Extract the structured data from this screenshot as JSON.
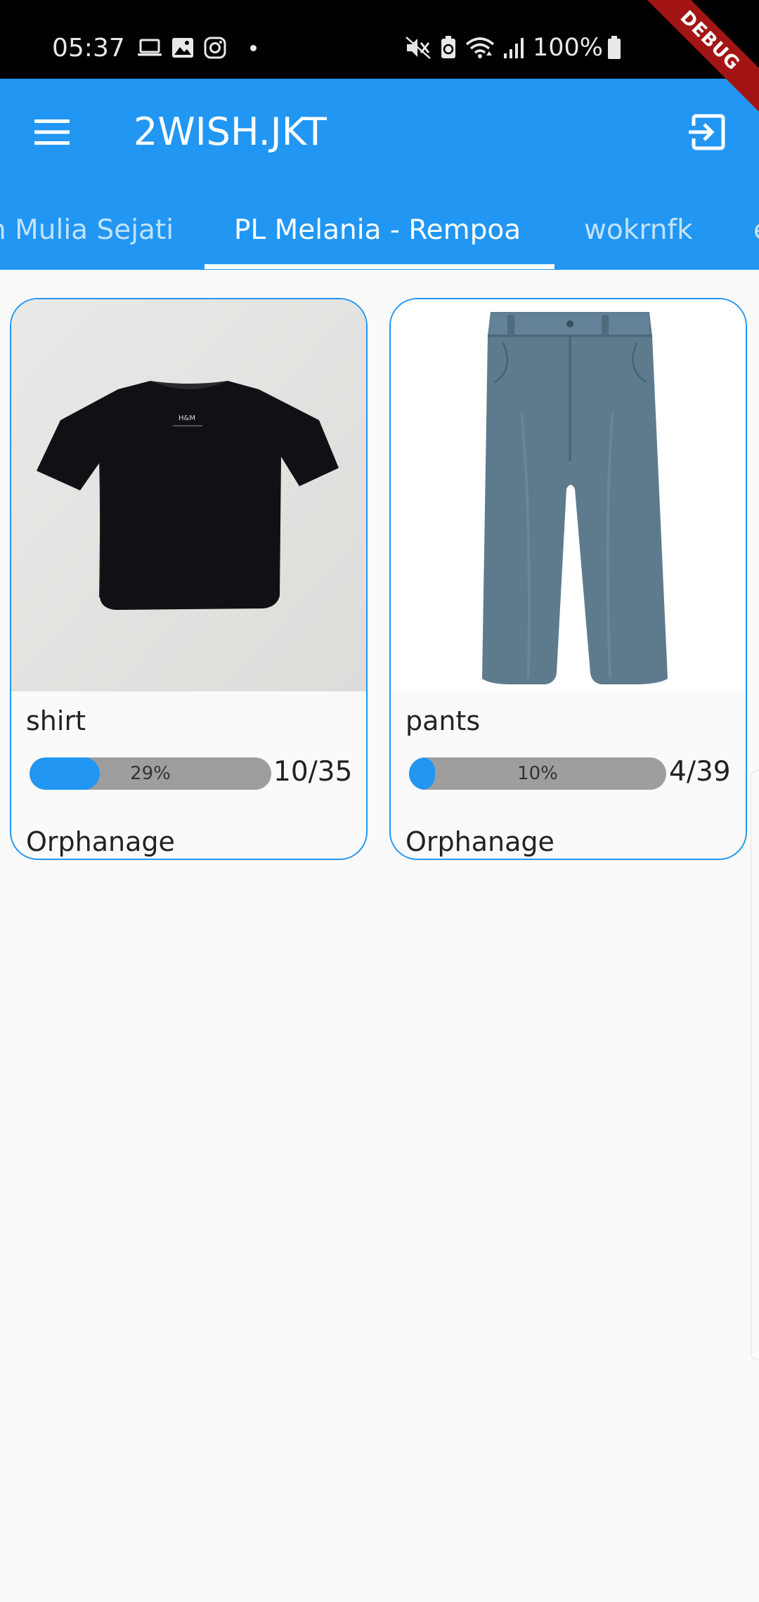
{
  "status_bar": {
    "time": "05:37",
    "battery_percent": "100%",
    "left_icons": [
      "laptop-icon",
      "gallery-icon",
      "instagram-icon",
      "notification-dot-icon"
    ],
    "right_icons": [
      "mute-icon",
      "battery-saver-icon",
      "wifi-icon",
      "signal-icon",
      "battery-icon"
    ]
  },
  "debug_banner": "DEBUG",
  "app_bar": {
    "title": "2WISH.JKT",
    "menu_icon": "menu-icon",
    "logout_icon": "logout-icon",
    "background_color": "#2196f3"
  },
  "tabs": [
    {
      "label": "Rumah Mulia Sejati",
      "visible_text": "n Mulia Sejati",
      "active": false
    },
    {
      "label": "PL Melania - Rempoa",
      "visible_text": "PL Melania - Rempoa",
      "active": true
    },
    {
      "label": "wokrnfk",
      "visible_text": "wokrnfk",
      "active": false
    },
    {
      "label": "e",
      "visible_text": "e",
      "active": false
    }
  ],
  "items": [
    {
      "name": "shirt",
      "image": "black-tshirt-image",
      "progress_label": "29%",
      "progress_fraction": 0.29,
      "count": "10/35",
      "category": "Orphanage"
    },
    {
      "name": "pants",
      "image": "grey-pants-image",
      "progress_label": "10%",
      "progress_fraction": 0.1,
      "count": "4/39",
      "category": "Orphanage"
    }
  ],
  "colors": {
    "accent": "#2196f3",
    "progress_track": "#9e9e9e",
    "page_background": "#fafafa",
    "debug_ribbon": "#a31515"
  }
}
